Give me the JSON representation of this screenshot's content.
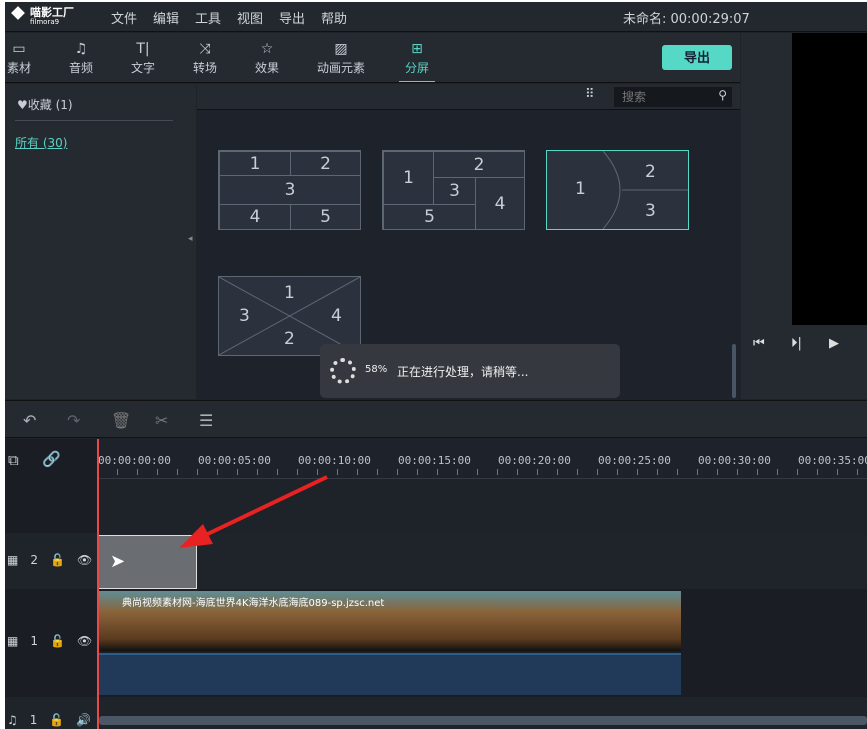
{
  "app": {
    "logo_cn": "喵影工厂",
    "logo_en": "filmora9",
    "project": "未命名: 00:00:29:07"
  },
  "menu": [
    "文件",
    "编辑",
    "工具",
    "视图",
    "导出",
    "帮助"
  ],
  "tabs": [
    {
      "label": "素材",
      "icon": "folder-icon"
    },
    {
      "label": "音频",
      "icon": "music-note-icon"
    },
    {
      "label": "文字",
      "icon": "text-icon"
    },
    {
      "label": "转场",
      "icon": "transition-icon"
    },
    {
      "label": "效果",
      "icon": "effects-icon"
    },
    {
      "label": "动画元素",
      "icon": "image-icon"
    },
    {
      "label": "分屏",
      "icon": "split-screen-icon",
      "active": true
    }
  ],
  "export_label": "导出",
  "sidebar": {
    "favorites": "♥收藏 (1)",
    "all": "所有 (30)"
  },
  "search": {
    "placeholder": "搜索"
  },
  "templates": [
    [
      "1",
      "2",
      "3",
      "4",
      "5"
    ],
    [
      "1",
      "2",
      "3",
      "4",
      "5"
    ],
    [
      "1",
      "2",
      "3"
    ],
    [
      "1",
      "3",
      "4",
      "2"
    ]
  ],
  "toast": {
    "percent": "58%",
    "message": "正在进行处理，请稍等..."
  },
  "ruler": [
    "00:00:00:00",
    "00:00:05:00",
    "00:00:10:00",
    "00:00:15:00",
    "00:00:20:00",
    "00:00:25:00",
    "00:00:30:00",
    "00:00:35:00"
  ],
  "tracks": [
    {
      "label": "2"
    },
    {
      "label": "1"
    },
    {
      "label": "1"
    }
  ],
  "clip": {
    "title": "典尚视频素材网-海底世界4K海洋水底海底089-sp.jzsc.net"
  },
  "colors": {
    "accent": "#55d8c6",
    "playhead": "#e84a4a"
  }
}
